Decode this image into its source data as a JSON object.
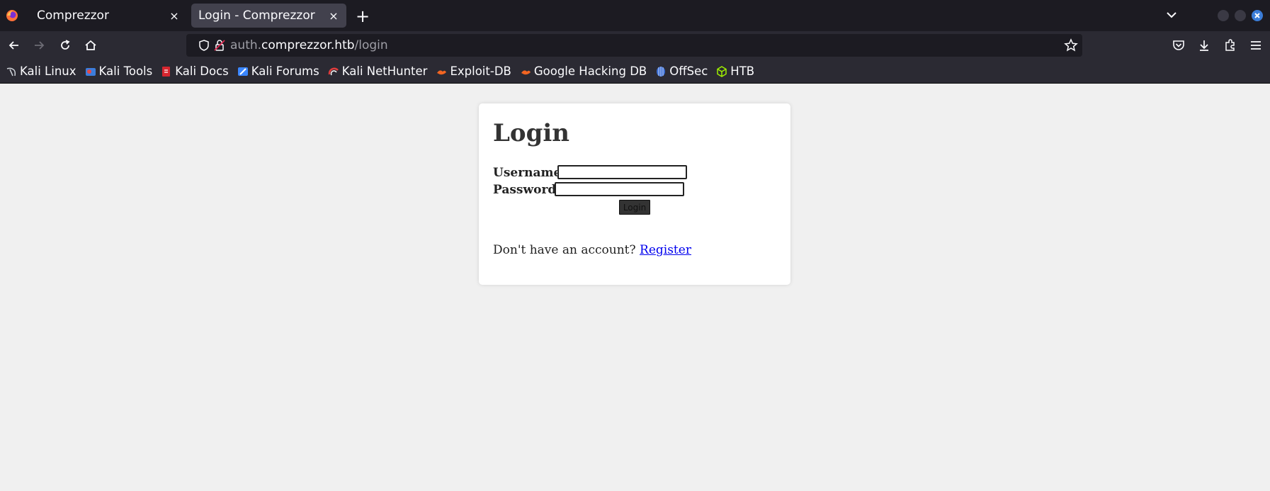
{
  "browser": {
    "tabs": [
      {
        "title": "Comprezzor",
        "active": false
      },
      {
        "title": "Login - Comprezzor",
        "active": true
      }
    ],
    "tab_close_symbol": "×",
    "new_tab_symbol": "+",
    "url": {
      "prefix": "auth.",
      "host": "comprezzor.htb",
      "path": "/login"
    },
    "bookmarks": [
      {
        "label": "Kali Linux",
        "icon": "kali-dragon-icon"
      },
      {
        "label": "Kali Tools",
        "icon": "kali-tools-icon"
      },
      {
        "label": "Kali Docs",
        "icon": "kali-docs-icon"
      },
      {
        "label": "Kali Forums",
        "icon": "kali-forums-icon"
      },
      {
        "label": "Kali NetHunter",
        "icon": "nethunter-icon"
      },
      {
        "label": "Exploit-DB",
        "icon": "exploit-db-icon"
      },
      {
        "label": "Google Hacking DB",
        "icon": "ghdb-icon"
      },
      {
        "label": "OffSec",
        "icon": "offsec-icon"
      },
      {
        "label": "HTB",
        "icon": "htb-cube-icon"
      }
    ]
  },
  "page": {
    "heading": "Login",
    "username_label": "Username:",
    "username_value": "",
    "password_label": "Password:",
    "password_value": "",
    "login_button": "Login",
    "register_prompt": "Don't have an account?",
    "register_link": "Register"
  },
  "colors": {
    "page_background": "#f0f0f0",
    "card_background": "#ffffff",
    "link": "#0000ee",
    "tab_bar": "#1c1b22",
    "toolbar": "#2b2a33"
  }
}
